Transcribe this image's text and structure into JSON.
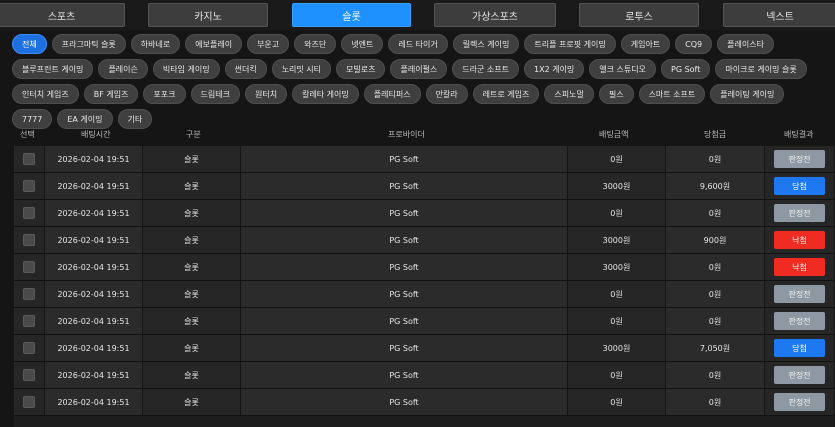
{
  "tabs": [
    {
      "label": "스포츠",
      "active": false
    },
    {
      "label": "카지노",
      "active": false
    },
    {
      "label": "슬롯",
      "active": true
    },
    {
      "label": "가상스포츠",
      "active": false
    },
    {
      "label": "로투스",
      "active": false
    },
    {
      "label": "넥스트",
      "active": false
    }
  ],
  "providers": [
    "전체",
    "프라그마틱 슬롯",
    "하바네로",
    "에보플레이",
    "부운고",
    "와즈단",
    "넷엔트",
    "레드 타이거",
    "릴렉스 게이밍",
    "트리플 프로핏 게이밍",
    "게임아트",
    "CQ9",
    "플레이스타",
    "블루프린트 게이밍",
    "플레이슨",
    "빅타임 게이밍",
    "썬더킥",
    "노리밋 시티",
    "모빌로츠",
    "플레이펄스",
    "드라군 소프트",
    "1X2 게이밍",
    "엘크 스튜디오",
    "PG Soft",
    "마이크로 게이밍 슬롯",
    "인터치 게임즈",
    "BF 게임즈",
    "포포크",
    "드림테크",
    "원터치",
    "칼레타 게이밍",
    "플레티퍼스",
    "만칼라",
    "레트로 게임즈",
    "스피노멀",
    "필스",
    "스마트 소프트",
    "플레이팅 게이밍",
    "7777",
    "EA 게이밍",
    "기타"
  ],
  "providers_active": "전체",
  "columns": {
    "select": "선택",
    "time": "배팅시간",
    "type": "구분",
    "provider": "프로바이더",
    "amount": "배팅금액",
    "win": "당첨금",
    "result": "배팅결과"
  },
  "rows": [
    {
      "time": "2026-02-04 19:51",
      "type": "슬롯",
      "provider": "PG Soft",
      "amount": "0원",
      "win": "0원",
      "result": "판정전",
      "status": "pending"
    },
    {
      "time": "2026-02-04 19:51",
      "type": "슬롯",
      "provider": "PG Soft",
      "amount": "3000원",
      "win": "9,600원",
      "result": "당첨",
      "status": "win"
    },
    {
      "time": "2026-02-04 19:51",
      "type": "슬롯",
      "provider": "PG Soft",
      "amount": "0원",
      "win": "0원",
      "result": "판정전",
      "status": "pending"
    },
    {
      "time": "2026-02-04 19:51",
      "type": "슬롯",
      "provider": "PG Soft",
      "amount": "3000원",
      "win": "900원",
      "result": "낙첨",
      "status": "lose"
    },
    {
      "time": "2026-02-04 19:51",
      "type": "슬롯",
      "provider": "PG Soft",
      "amount": "3000원",
      "win": "0원",
      "result": "낙첨",
      "status": "lose"
    },
    {
      "time": "2026-02-04 19:51",
      "type": "슬롯",
      "provider": "PG Soft",
      "amount": "0원",
      "win": "0원",
      "result": "판정전",
      "status": "pending"
    },
    {
      "time": "2026-02-04 19:51",
      "type": "슬롯",
      "provider": "PG Soft",
      "amount": "0원",
      "win": "0원",
      "result": "판정전",
      "status": "pending"
    },
    {
      "time": "2026-02-04 19:51",
      "type": "슬롯",
      "provider": "PG Soft",
      "amount": "3000원",
      "win": "7,050원",
      "result": "당첨",
      "status": "win"
    },
    {
      "time": "2026-02-04 19:51",
      "type": "슬롯",
      "provider": "PG Soft",
      "amount": "0원",
      "win": "0원",
      "result": "판정전",
      "status": "pending"
    },
    {
      "time": "2026-02-04 19:51",
      "type": "슬롯",
      "provider": "PG Soft",
      "amount": "0원",
      "win": "0원",
      "result": "판정전",
      "status": "pending"
    }
  ],
  "colors": {
    "accent": "#1e90ff",
    "win": "#1e78f0",
    "lose": "#f02c22",
    "pending": "#8e98a3"
  }
}
